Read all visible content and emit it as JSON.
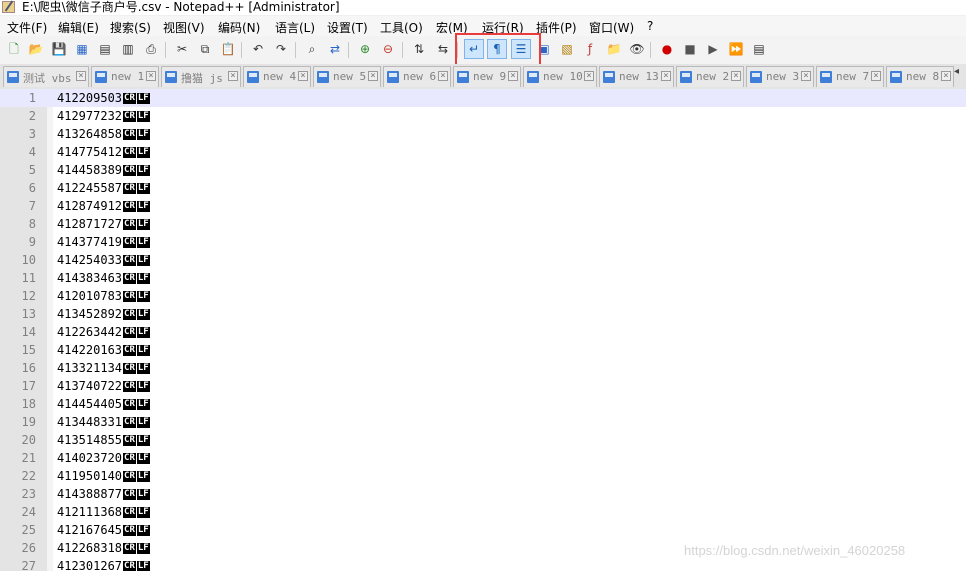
{
  "window": {
    "title": "E:\\爬虫\\微信子商户号.csv - Notepad++ [Administrator]"
  },
  "menu": [
    "文件(F)",
    "编辑(E)",
    "搜索(S)",
    "视图(V)",
    "编码(N)",
    "语言(L)",
    "设置(T)",
    "工具(O)",
    "宏(M)",
    "运行(R)",
    "插件(P)",
    "窗口(W)",
    "?"
  ],
  "toolbar": {
    "buttons": [
      {
        "name": "new-file-icon",
        "glyph": "🗋"
      },
      {
        "name": "open-file-icon",
        "glyph": "📂"
      },
      {
        "name": "save-icon",
        "glyph": "💾"
      },
      {
        "name": "save-all-icon",
        "glyph": "▦"
      },
      {
        "name": "close-icon",
        "glyph": "▤"
      },
      {
        "name": "close-all-icon",
        "glyph": "▥"
      },
      {
        "name": "print-icon",
        "glyph": "⎙"
      },
      {
        "name": "cut-icon",
        "glyph": "✂"
      },
      {
        "name": "copy-icon",
        "glyph": "⧉"
      },
      {
        "name": "paste-icon",
        "glyph": "📋"
      },
      {
        "name": "undo-icon",
        "glyph": "↶"
      },
      {
        "name": "redo-icon",
        "glyph": "↷"
      },
      {
        "name": "find-icon",
        "glyph": "⌕"
      },
      {
        "name": "replace-icon",
        "glyph": "⇄"
      },
      {
        "name": "zoom-in-icon",
        "glyph": "⊕"
      },
      {
        "name": "zoom-out-icon",
        "glyph": "⊖"
      },
      {
        "name": "sync-vertical-icon",
        "glyph": "⇅"
      },
      {
        "name": "sync-horizontal-icon",
        "glyph": "⇆"
      },
      {
        "name": "word-wrap-icon",
        "glyph": "↵"
      },
      {
        "name": "show-all-characters-icon",
        "glyph": "¶"
      },
      {
        "name": "indent-guide-icon",
        "glyph": "☰"
      },
      {
        "name": "user-defined-language-icon",
        "glyph": "▣"
      },
      {
        "name": "document-map-icon",
        "glyph": "▧"
      },
      {
        "name": "function-list-icon",
        "glyph": "ƒ"
      },
      {
        "name": "folder-as-workspace-icon",
        "glyph": "📁"
      },
      {
        "name": "monitoring-icon",
        "glyph": "👁"
      },
      {
        "name": "macro-record-icon",
        "glyph": "●"
      },
      {
        "name": "macro-stop-icon",
        "glyph": "■"
      },
      {
        "name": "macro-play-icon",
        "glyph": "▶"
      },
      {
        "name": "macro-play-multiple-icon",
        "glyph": "⏩"
      },
      {
        "name": "macro-save-icon",
        "glyph": "▤"
      }
    ]
  },
  "tabs": [
    {
      "label": "测试 vbs",
      "selected": false
    },
    {
      "label": "new 1",
      "selected": false
    },
    {
      "label": "撸猫 js",
      "selected": false
    },
    {
      "label": "new 4",
      "selected": false
    },
    {
      "label": "new 5",
      "selected": false
    },
    {
      "label": "new 6",
      "selected": false
    },
    {
      "label": "new 9",
      "selected": false
    },
    {
      "label": "new 10",
      "selected": false
    },
    {
      "label": "new 13",
      "selected": false
    },
    {
      "label": "new 2",
      "selected": false
    },
    {
      "label": "new 3",
      "selected": false
    },
    {
      "label": "new 7",
      "selected": false
    },
    {
      "label": "new 8",
      "selected": false
    }
  ],
  "editor": {
    "eol_cr": "CR",
    "eol_lf": "LF",
    "lines": [
      {
        "n": "1",
        "text": "412209503"
      },
      {
        "n": "2",
        "text": "412977232"
      },
      {
        "n": "3",
        "text": "413264858"
      },
      {
        "n": "4",
        "text": "414775412"
      },
      {
        "n": "5",
        "text": "414458389"
      },
      {
        "n": "6",
        "text": "412245587"
      },
      {
        "n": "7",
        "text": "412874912"
      },
      {
        "n": "8",
        "text": "412871727"
      },
      {
        "n": "9",
        "text": "414377419"
      },
      {
        "n": "10",
        "text": "414254033"
      },
      {
        "n": "11",
        "text": "414383463"
      },
      {
        "n": "12",
        "text": "412010783"
      },
      {
        "n": "13",
        "text": "413452892"
      },
      {
        "n": "14",
        "text": "412263442"
      },
      {
        "n": "15",
        "text": "414220163"
      },
      {
        "n": "16",
        "text": "413321134"
      },
      {
        "n": "17",
        "text": "413740722"
      },
      {
        "n": "18",
        "text": "414454405"
      },
      {
        "n": "19",
        "text": "413448331"
      },
      {
        "n": "20",
        "text": "413514855"
      },
      {
        "n": "21",
        "text": "414023720"
      },
      {
        "n": "22",
        "text": "411950140"
      },
      {
        "n": "23",
        "text": "414388877"
      },
      {
        "n": "24",
        "text": "412111368"
      },
      {
        "n": "25",
        "text": "412167645"
      },
      {
        "n": "26",
        "text": "412268318"
      },
      {
        "n": "27",
        "text": "412301267"
      }
    ]
  },
  "watermark": "https://blog.csdn.net/weixin_46020258"
}
